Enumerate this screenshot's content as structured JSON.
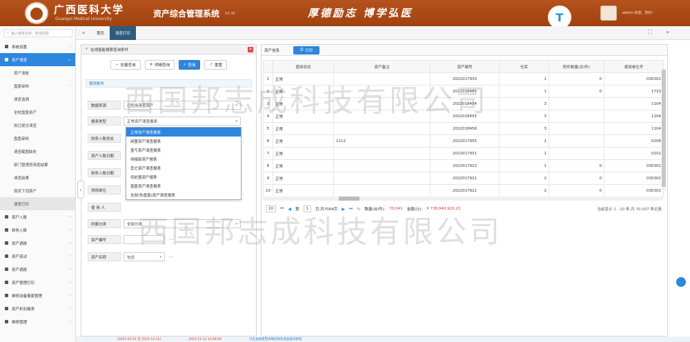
{
  "header": {
    "university_name": "广西医科大学",
    "university_en": "Guangxi Medical University",
    "system_title": "资产综合管理系统",
    "version": "V3.36",
    "motto": "厚德励志 博学弘医",
    "user_info": "admin 欢迎，您好!"
  },
  "sidebar": {
    "search_placeholder": "输入菜单名称、拼音匹配",
    "items": [
      {
        "label": "系统设置",
        "icon": "settings-icon"
      },
      {
        "label": "资产清查",
        "icon": "check-icon",
        "active": true
      }
    ],
    "sub_items": [
      "资产清册",
      "盘盈审核",
      "清查追溯",
      "全校盘盈资产",
      "拟已提交清查",
      "盘盈审核",
      "清查截图缺失",
      "部门管理员清查结果",
      "清查结果",
      "现状下消资产",
      "清查打印"
    ],
    "bottom_items": [
      "资产入账",
      "财务入账",
      "资产调拨",
      "资产变动",
      "资产调拨",
      "资产管理打印",
      "维修设备报废管理",
      "资产折旧报表",
      "维修管理"
    ]
  },
  "tabs": {
    "items": [
      "首页",
      "清查打印"
    ]
  },
  "search_panel": {
    "title": "在线智能搜索查询条件",
    "buttons": [
      "批量查询",
      "明细查询",
      "查询",
      "重置"
    ],
    "section_title": "使用条件",
    "fields": [
      {
        "label": "数据来源",
        "value": "已在用清查资产"
      },
      {
        "label": "报表类型",
        "value": "正常资产清查报表"
      },
      {
        "label": "财务入账状态",
        "value": ""
      },
      {
        "label": "资产入账日期",
        "value": ""
      },
      {
        "label": "财务入账日期",
        "value": ""
      },
      {
        "label": "领用单位",
        "value": ""
      },
      {
        "label": "使 用 人",
        "value": ""
      },
      {
        "label": "所属分类",
        "value": "全部分类"
      },
      {
        "label": "资产编号",
        "value": ""
      },
      {
        "label": "资产名称",
        "value": "包含"
      }
    ],
    "dropdown_options": [
      "正常资产清查报表",
      "闲置资产清查报表",
      "盘亏资产清查报表",
      "待报废资产报表",
      "其它资产清查报表",
      "待处置资产报表",
      "盘盈资产清查报表",
      "全部(失盘盈)资产清查报表"
    ]
  },
  "main": {
    "tab_label": "资产信息",
    "print_button": "打印",
    "columns": [
      "",
      "使用状态",
      "资产备注",
      "资产编号",
      "仓库",
      "附件数量(总/件)",
      "使用单位号"
    ],
    "rows": [
      [
        "1",
        "正常",
        "",
        "2022017933",
        "1",
        "0",
        "030302"
      ],
      [
        "2",
        "正常",
        "",
        "2022018485",
        "1",
        "0",
        "1733"
      ],
      [
        "3",
        "正常",
        "",
        "2022018454",
        "3",
        "",
        "1104"
      ],
      [
        "4",
        "正常",
        "",
        "2022018455",
        "3",
        "",
        "1104"
      ],
      [
        "5",
        "正常",
        "",
        "2022018456",
        "3",
        "",
        "1104"
      ],
      [
        "6",
        "正常",
        "1112",
        "2022017955",
        "1",
        "",
        "0206"
      ],
      [
        "7",
        "正常",
        "",
        "2022017931",
        "1",
        "",
        "0102"
      ],
      [
        "8",
        "正常",
        "",
        "2022017923",
        "1",
        "0",
        "030302"
      ],
      [
        "9",
        "正常",
        "",
        "2022017921",
        "2",
        "0",
        "030302"
      ],
      [
        "10",
        "正常",
        "",
        "2022017922",
        "2",
        "0",
        "030302"
      ]
    ],
    "pager": {
      "page_size": "10",
      "page_label": "第",
      "page_number": "1",
      "page_total": "页,共7004页",
      "quantity_label": "数量(台/件):",
      "quantity": "70,041",
      "amount_label": "金额(元):",
      "amount": "¥ 738,940,920.23",
      "summary": "当前显示 1 - 10 条,共 70,037 条记录"
    }
  },
  "watermark": "西国邦志成科技有限公司",
  "statusbar": {
    "date_range_a": "[2022-01-01 至 2022-12-31]",
    "date_range_b": "2022-11-12 14:08:06",
    "notice": "点击查看使用详细说明及清查操作教程"
  },
  "colors": {
    "header": "#a84a17",
    "accent": "#2e86de",
    "alert": "#d9342b"
  }
}
